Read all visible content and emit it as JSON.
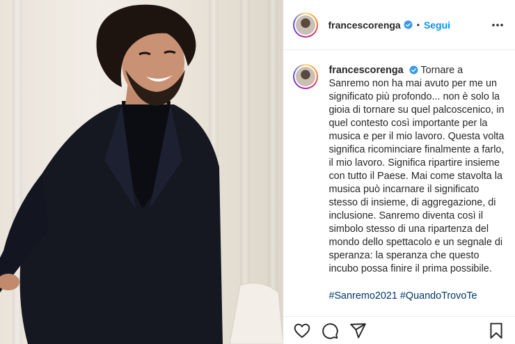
{
  "header": {
    "username": "francescorenga",
    "separator": "•",
    "follow_label": "Segui"
  },
  "caption": {
    "username": "francescorenga",
    "text": "Tornare a Sanremo non ha mai avuto per me un significato più profondo... non è solo la gioia di tornare su quel palcoscenico, in quel contesto così importante per la musica e per il mio lavoro. Questa volta significa ricominciare finalmente a farlo, il mio lavoro. Significa ripartire insieme con tutto il Paese. Mai come stavolta la musica può incarnare il significato stesso di insieme, di aggregazione, di inclusione. Sanremo diventa così il simbolo stesso di una ripartenza del mondo dello spettacolo e un segnale di speranza: la speranza che questo incubo possa finire il prima possibile.",
    "hashtags": [
      "#Sanremo2021",
      "#QuandoTrovoTe"
    ]
  },
  "icons": {
    "verified": "verified-badge-icon",
    "more": "more-options-icon",
    "like": "heart-icon",
    "comment": "comment-icon",
    "share": "share-icon",
    "save": "bookmark-icon"
  },
  "colors": {
    "follow": "#0095f6",
    "verified": "#3897f0",
    "hashtag": "#00376b"
  }
}
